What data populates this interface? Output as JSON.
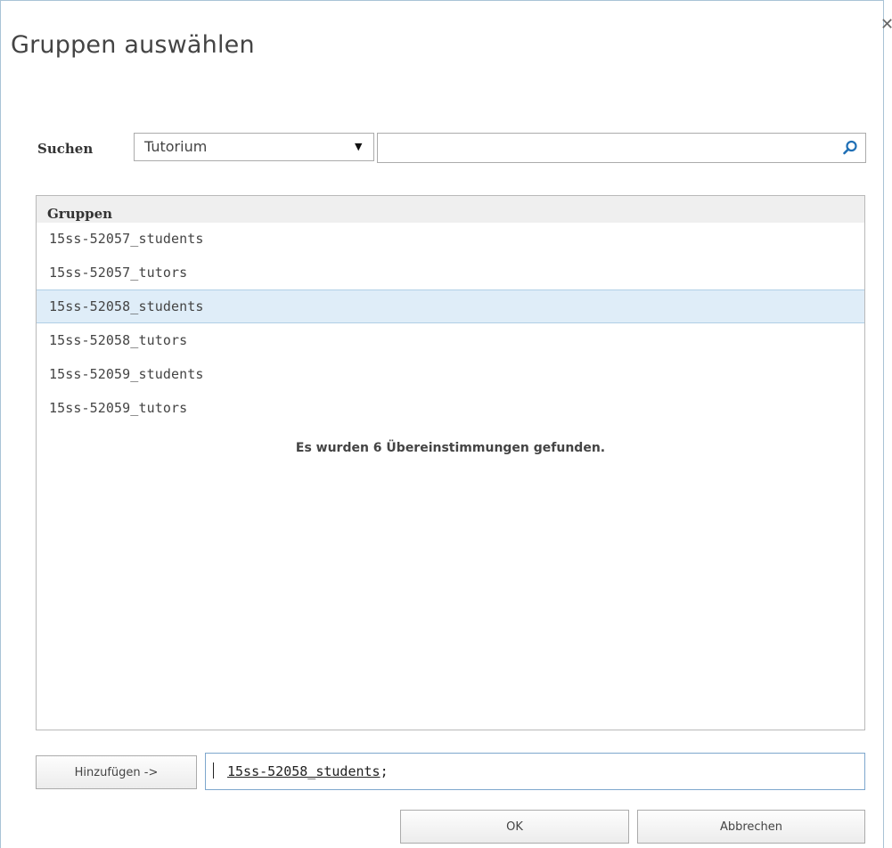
{
  "dialog": {
    "title": "Gruppen auswählen",
    "close_symbol": "✕"
  },
  "search": {
    "label": "Suchen",
    "scope_value": "Tutorium",
    "query_value": "",
    "search_icon": "search-icon"
  },
  "results": {
    "header": "Gruppen",
    "rows": [
      {
        "name": "15ss-52057_students",
        "selected": false
      },
      {
        "name": "15ss-52057_tutors",
        "selected": false
      },
      {
        "name": "15ss-52058_students",
        "selected": true
      },
      {
        "name": "15ss-52058_tutors",
        "selected": false
      },
      {
        "name": "15ss-52059_students",
        "selected": false
      },
      {
        "name": "15ss-52059_tutors",
        "selected": false
      }
    ],
    "match_message": "Es wurden 6 Übereinstimmungen gefunden."
  },
  "footer": {
    "add_label": "Hinzufügen ->",
    "selected_value": "15ss-52058_students",
    "separator": ";",
    "ok_label": "OK",
    "cancel_label": "Abbrechen"
  },
  "colors": {
    "selected_row_bg": "#dfedf8",
    "header_bg": "#efefef",
    "accent_border": "#7ea7cd"
  }
}
